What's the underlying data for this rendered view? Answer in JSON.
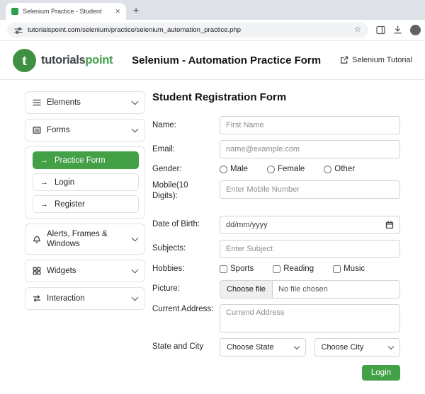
{
  "browser": {
    "tab_title": "Selenium Practice - Student",
    "url": "tutorialspoint.com/selenium/practice/selenium_automation_practice.php"
  },
  "icons": {
    "close": "✕",
    "new_tab": "+",
    "star": "☆",
    "arrow_right": "→"
  },
  "header": {
    "logo_part1": "tutorials",
    "logo_part2": "point",
    "title": "Selenium - Automation Practice Form",
    "tutorial_link": "Selenium Tutorial"
  },
  "sidebar": {
    "elements": "Elements",
    "forms": "Forms",
    "practice_form": "Practice Form",
    "login": "Login",
    "register": "Register",
    "alerts": "Alerts, Frames & Windows",
    "widgets": "Widgets",
    "interaction": "Interaction"
  },
  "form": {
    "title": "Student Registration Form",
    "name_label": "Name:",
    "name_placeholder": "First Name",
    "email_label": "Email:",
    "email_placeholder": "name@example.com",
    "gender_label": "Gender:",
    "gender_options": [
      "Male",
      "Female",
      "Other"
    ],
    "mobile_label": "Mobile(10 Digits):",
    "mobile_placeholder": "Enter Mobile Number",
    "dob_label": "Date of Birth:",
    "dob_value": "dd/mm/yyyy",
    "subjects_label": "Subjects:",
    "subjects_placeholder": "Enter Subject",
    "hobbies_label": "Hobbies:",
    "hobbies_options": [
      "Sports",
      "Reading",
      "Music"
    ],
    "picture_label": "Picture:",
    "file_button": "Choose file",
    "file_status": "No file chosen",
    "address_label": "Current Address:",
    "address_placeholder": "Currend Address",
    "state_city_label": "State and City",
    "state_placeholder": "Choose State",
    "city_placeholder": "Choose City",
    "submit_label": "Login"
  },
  "colors": {
    "accent_green": "#43a047",
    "logo_green": "#3e9142",
    "input_border": "#ced4da",
    "sidebar_border": "#dee2e6",
    "tabstrip_bg": "#dee1e6",
    "omnibox_bg": "#f1f3f4"
  }
}
